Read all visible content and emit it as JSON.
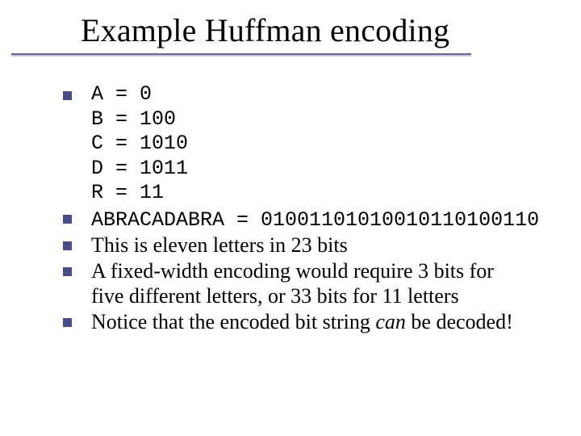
{
  "title": "Example Huffman encoding",
  "codes": {
    "a": "A = 0",
    "b": "B = 100",
    "c": "C = 1010",
    "d": "D = 1011",
    "r": "R = 11"
  },
  "lines": {
    "encoded": "ABRACADABRA = 01001101010010110100110",
    "bits": "This is eleven letters in 23 bits",
    "fixed1": "A fixed-width encoding would require 3 bits for",
    "fixed2": "five different letters, or 33 bits for 11 letters",
    "decode_pre": "Notice that the encoded bit string ",
    "decode_em": "can",
    "decode_post": " be decoded!"
  }
}
